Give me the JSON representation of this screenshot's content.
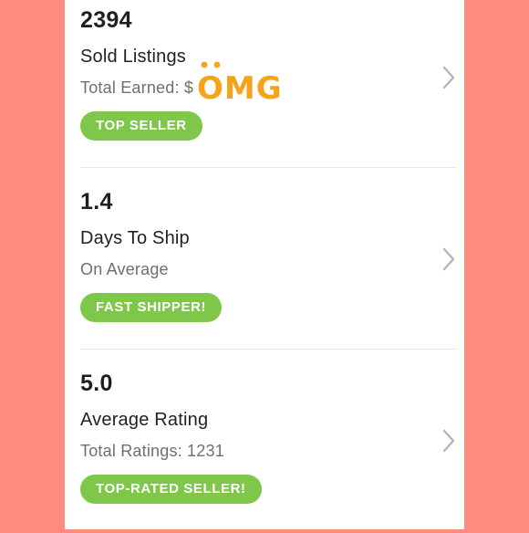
{
  "colors": {
    "background": "#FF8A7E",
    "card": "#FFFFFF",
    "badge": "#7EC74A",
    "sticker": "#F7A21B"
  },
  "stats": [
    {
      "value": "2394",
      "label": "Sold Listings",
      "sub": "Total Earned: $",
      "badge": "TOP SELLER",
      "chevron": "chevron-right-icon"
    },
    {
      "value": "1.4",
      "label": "Days To Ship",
      "sub": "On Average",
      "badge": "FAST SHIPPER!",
      "chevron": "chevron-right-icon"
    },
    {
      "value": "5.0",
      "label": "Average Rating",
      "sub": "Total Ratings: 1231",
      "badge": "TOP-RATED SELLER!",
      "chevron": "chevron-right-icon"
    }
  ],
  "sticker": {
    "text": "OMG",
    "icon": "omg-sticker-icon"
  }
}
